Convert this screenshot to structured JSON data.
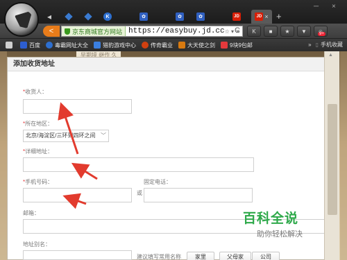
{
  "browser": {
    "tabs": [
      {
        "icon": "back-arrow-icon",
        "active": false
      },
      {
        "icon": "diamond-favicon-icon",
        "active": false
      },
      {
        "icon": "diamond-favicon-icon",
        "active": false
      },
      {
        "icon": "k-favicon-icon",
        "label": "K",
        "active": false
      },
      {
        "icon": "paw-favicon-icon",
        "active": false
      },
      {
        "icon": "paw-favicon-icon",
        "active": false
      },
      {
        "icon": "paw-favicon-icon",
        "active": false
      },
      {
        "icon": "jd-favicon-icon",
        "label": "JD",
        "active": false
      },
      {
        "icon": "jd-favicon-icon",
        "label": "JD",
        "active": true
      }
    ],
    "close_glyph": "×",
    "new_tab_glyph": "+",
    "window_controls": [
      "─",
      "×"
    ],
    "back_glyph": "<",
    "site_badge": "京东商城官方网站",
    "url": "https://easybuy.jd.cc",
    "url_icons": "☆ ▾ ✕",
    "refresh_glyph": "C",
    "toolbar_buttons": [
      "K",
      "■",
      "★",
      "▼",
      "☺"
    ],
    "badge": "9+"
  },
  "bookmarks": [
    {
      "label": "",
      "icon": "home-icon",
      "color": "#cccccc"
    },
    {
      "label": "百度",
      "icon": "paw-icon",
      "color": "#2d5ed0"
    },
    {
      "label": "毒霸网址大全",
      "icon": "k-icon",
      "color": "#2d6fd0"
    },
    {
      "label": "猎豹游戏中心",
      "icon": "paw-icon",
      "color": "#3b7fe0"
    },
    {
      "label": "传奇霸业",
      "icon": "red-circle-icon",
      "color": "#d04010"
    },
    {
      "label": "大天使之剑",
      "icon": "sword-icon",
      "color": "#d87a10"
    },
    {
      "label": "9块9包邮",
      "icon": "tag-icon",
      "color": "#e4393c"
    }
  ],
  "bookmarks_more": "»",
  "bookmarks_folder": "手机收藏",
  "page_behind_text": "早期境  继作   久",
  "dialog": {
    "title": "添加收货地址",
    "required_mark": "*",
    "receiver_label": "收货人：",
    "region_label": "所在地区：",
    "region_value": "北京/海淀区/三环到四环之间",
    "address_label": "详细地址：",
    "mobile_label": "手机号码：",
    "or_label": "或",
    "phone_label": "固定电话：",
    "email_label": "邮箱：",
    "alias_label": "地址别名：",
    "alias_hint": "建议填写常用名称",
    "alias_buttons": [
      "家里",
      "父母家",
      "公司"
    ]
  },
  "watermark": {
    "title": "百科全说",
    "subtitle": "助你轻松解决"
  },
  "annotation_color": "#e23b2e"
}
